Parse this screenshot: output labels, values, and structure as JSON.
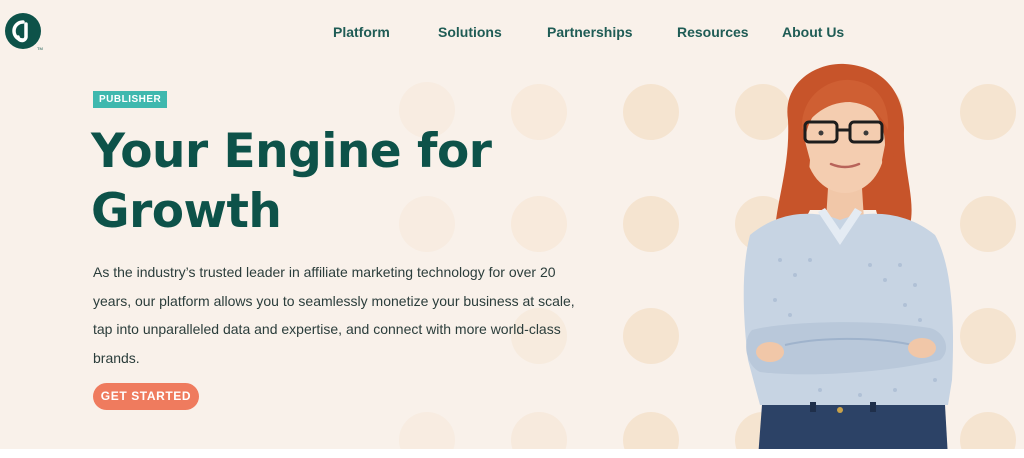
{
  "brand": {
    "logo_text": "CJ",
    "logo_color": "#0d5249",
    "trademark": "TM"
  },
  "nav": {
    "items": [
      {
        "label": "Platform"
      },
      {
        "label": "Solutions"
      },
      {
        "label": "Partnerships"
      },
      {
        "label": "Resources"
      },
      {
        "label": "About Us"
      }
    ]
  },
  "hero": {
    "badge": "PUBLISHER",
    "headline": "Your Engine for Growth",
    "body": "As the industry’s trusted leader in affiliate marketing technology for over 20 years, our platform allows you to seamlessly monetize your business at scale, tap into unparalleled data and expertise, and connect with more world-class brands.",
    "cta_label": "GET STARTED"
  },
  "colors": {
    "background": "#f9f1ea",
    "accent_teal": "#3fb8ae",
    "headline_green": "#0d5249",
    "cta_coral": "#ef7b5e",
    "dot_peach": "#f6e3cf"
  },
  "icons": {
    "logo": "cj-logo-icon"
  },
  "image": {
    "subject": "woman-with-glasses-arms-crossed"
  }
}
